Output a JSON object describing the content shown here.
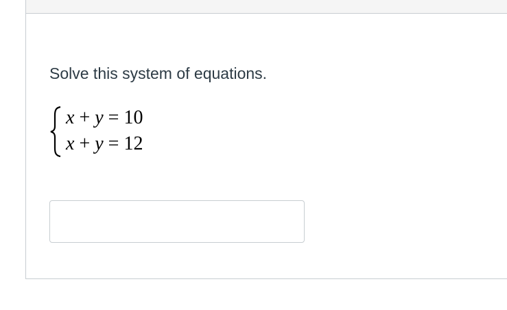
{
  "question": {
    "prompt": "Solve this system of equations.",
    "equations": [
      {
        "lhs_var1": "x",
        "op": "+",
        "lhs_var2": "y",
        "eq": "=",
        "rhs": "10"
      },
      {
        "lhs_var1": "x",
        "op": "+",
        "lhs_var2": "y",
        "eq": "=",
        "rhs": "12"
      }
    ],
    "answer": {
      "value": "",
      "placeholder": ""
    }
  },
  "colors": {
    "border": "#c7cdd1",
    "text": "#2d3b45",
    "header_strip": "#f5f5f5"
  }
}
